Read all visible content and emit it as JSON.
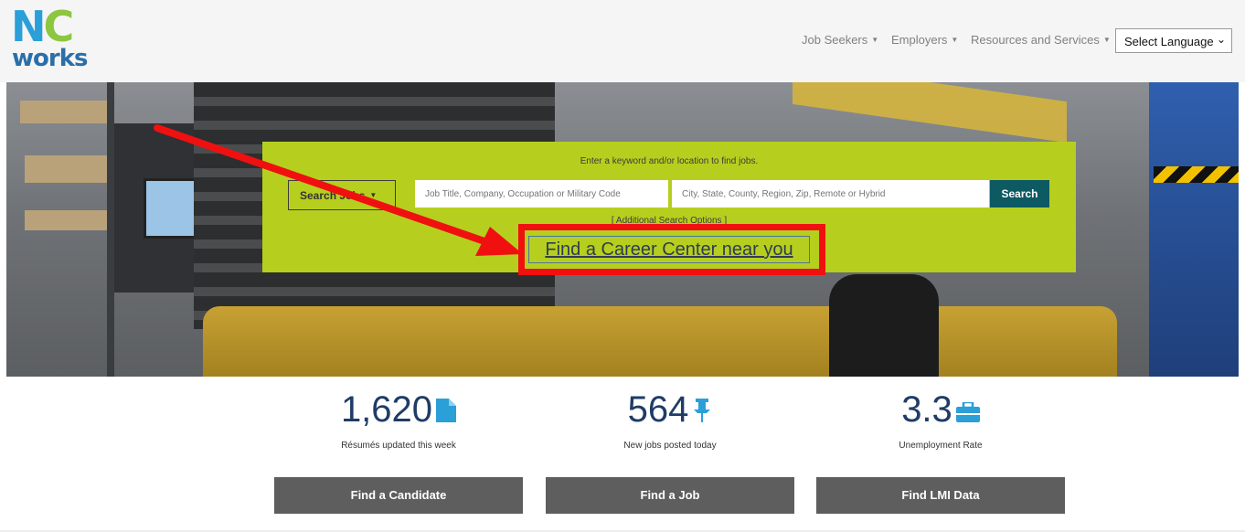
{
  "logo": {
    "line1_n": "N",
    "line1_c": "C",
    "line2": "works"
  },
  "nav": {
    "items": [
      {
        "label": "Job Seekers"
      },
      {
        "label": "Employers"
      },
      {
        "label": "Resources and Services"
      }
    ],
    "language_select": "Select Language"
  },
  "search_panel": {
    "hint": "Enter a keyword and/or location to find jobs.",
    "search_type": "Search Jobs",
    "keyword_placeholder": "Job Title, Company, Occupation or Military Code",
    "location_placeholder": "City, State, County, Region, Zip, Remote or Hybrid",
    "search_button": "Search",
    "advanced_link": "[ Additional Search Options ]",
    "career_center_link": "Find a Career Center near you"
  },
  "stats": [
    {
      "value": "1,620",
      "label": "Résumés updated this week",
      "icon": "document-icon"
    },
    {
      "value": "564",
      "label": "New jobs posted today",
      "icon": "pin-icon"
    },
    {
      "value": "3.3",
      "label": "Unemployment Rate",
      "icon": "briefcase-icon"
    }
  ],
  "actions": [
    {
      "label": "Find a Candidate"
    },
    {
      "label": "Find a Job"
    },
    {
      "label": "Find LMI Data"
    }
  ],
  "colors": {
    "accent_green": "#b6cf1e",
    "search_button": "#0d5a63",
    "stat_text": "#1f3c66",
    "stat_icon": "#2a9fd8",
    "annotation_red": "#f01010",
    "action_button": "#5e5e5e"
  }
}
